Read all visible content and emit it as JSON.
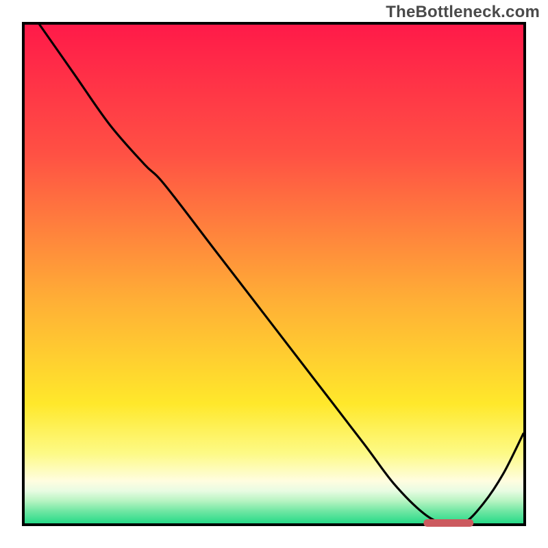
{
  "watermark": "TheBottleneck.com",
  "chart_data": {
    "type": "line",
    "title": "",
    "xlabel": "",
    "ylabel": "",
    "xlim": [
      0,
      100
    ],
    "ylim": [
      0,
      100
    ],
    "line": {
      "name": "bottleneck-curve",
      "x": [
        3,
        10,
        17,
        24,
        28,
        38,
        48,
        58,
        68,
        74,
        80,
        84,
        88,
        92,
        96,
        100
      ],
      "y": [
        100,
        90,
        80,
        72,
        68,
        55,
        42,
        29,
        16,
        8,
        2,
        0,
        0,
        4,
        10,
        18
      ]
    },
    "optimal_marker": {
      "x_start": 80,
      "x_end": 90,
      "y": 0
    },
    "background_gradient_stops": [
      {
        "offset": 0.0,
        "color": "#ff1a49"
      },
      {
        "offset": 0.26,
        "color": "#ff5144"
      },
      {
        "offset": 0.55,
        "color": "#ffae36"
      },
      {
        "offset": 0.76,
        "color": "#ffe82b"
      },
      {
        "offset": 0.86,
        "color": "#fdfa86"
      },
      {
        "offset": 0.915,
        "color": "#fffde0"
      },
      {
        "offset": 0.935,
        "color": "#e8fce2"
      },
      {
        "offset": 0.955,
        "color": "#b7f4c2"
      },
      {
        "offset": 0.975,
        "color": "#72e7a4"
      },
      {
        "offset": 1.0,
        "color": "#27da88"
      }
    ]
  }
}
